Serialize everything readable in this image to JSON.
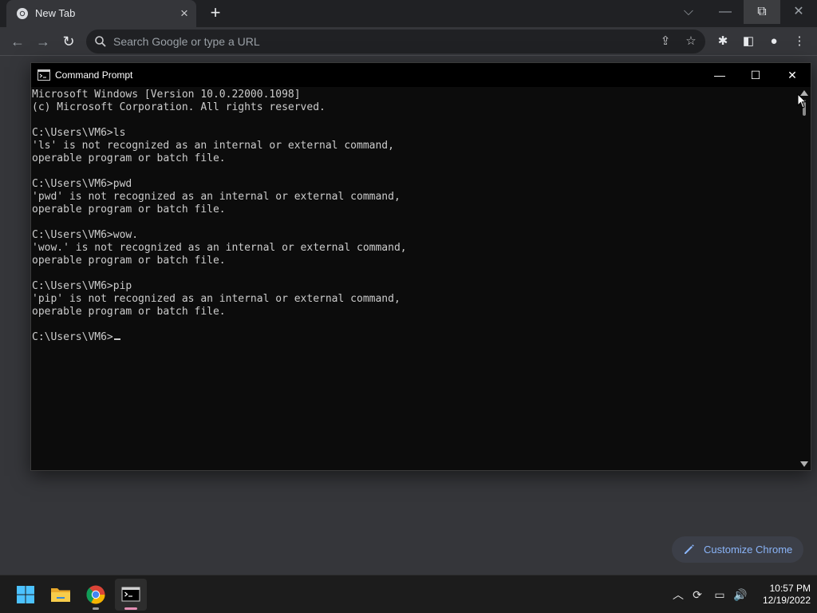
{
  "browser": {
    "tab": {
      "title": "New Tab",
      "close_icon": "close-icon"
    },
    "new_tab_icon": "plus-icon",
    "window_controls": [
      "chevron-down-icon",
      "minimize-icon",
      "restore-icon",
      "close-icon"
    ],
    "nav": [
      "back-arrow-icon",
      "forward-arrow-icon",
      "reload-icon"
    ],
    "omnibox": {
      "placeholder": "Search Google or type a URL"
    },
    "toolbar_icons": [
      "share-icon",
      "star-icon",
      "extensions-icon",
      "side-panel-icon",
      "profile-icon",
      "menu-icon"
    ]
  },
  "customize": {
    "label": "Customize Chrome"
  },
  "cmd": {
    "title": "Command Prompt",
    "lines": [
      "Microsoft Windows [Version 10.0.22000.1098]",
      "(c) Microsoft Corporation. All rights reserved.",
      "",
      "C:\\Users\\VM6>ls",
      "'ls' is not recognized as an internal or external command,",
      "operable program or batch file.",
      "",
      "C:\\Users\\VM6>pwd",
      "'pwd' is not recognized as an internal or external command,",
      "operable program or batch file.",
      "",
      "C:\\Users\\VM6>wow.",
      "'wow.' is not recognized as an internal or external command,",
      "operable program or batch file.",
      "",
      "C:\\Users\\VM6>pip",
      "'pip' is not recognized as an internal or external command,",
      "operable program or batch file.",
      ""
    ],
    "prompt": "C:\\Users\\VM6>"
  },
  "taskbar": {
    "apps": [
      "windows-start-icon",
      "file-explorer-icon",
      "chrome-icon",
      "command-prompt-icon"
    ],
    "tray_icons": [
      "chevron-up-icon",
      "sync-icon",
      "network-icon",
      "volume-icon"
    ],
    "time": "10:57 PM",
    "date": "12/19/2022"
  },
  "colors": {
    "chrome_dark": "#202124",
    "chrome_surface": "#35363a",
    "link_blue": "#8ab4f8",
    "console_bg": "#0c0c0c",
    "console_text": "#cccccc"
  }
}
